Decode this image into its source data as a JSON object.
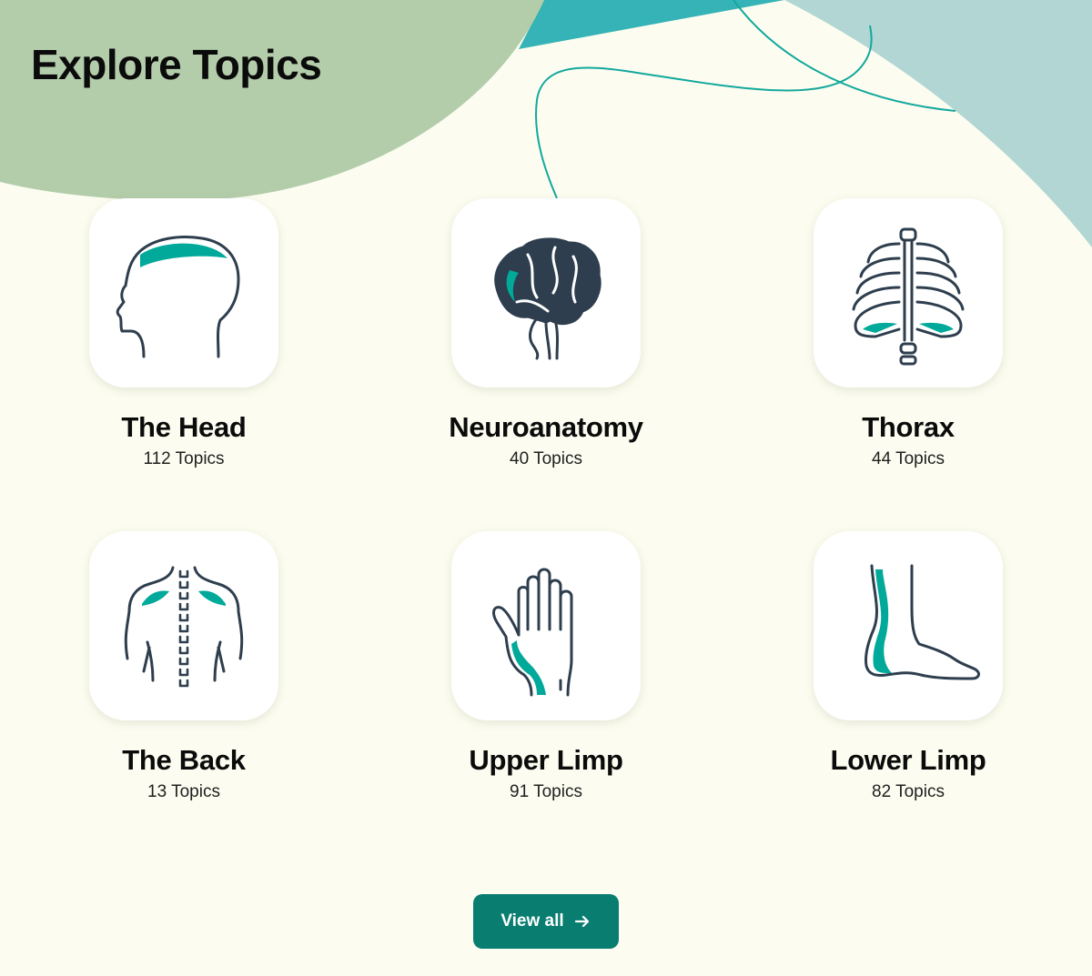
{
  "header": {
    "title": "Explore Topics"
  },
  "colors": {
    "background": "#fcfdf0",
    "sage_blob": "#b3cdaa",
    "teal_blob": "#36b3b6",
    "light_teal_blob": "#b1d6d3",
    "accent": "#00a99a",
    "icon_stroke": "#2e3e4e",
    "button": "#087d70"
  },
  "topics": [
    {
      "title": "The Head",
      "count": "112 Topics",
      "icon": "head-icon"
    },
    {
      "title": "Neuroanatomy",
      "count": "40 Topics",
      "icon": "brain-icon"
    },
    {
      "title": "Thorax",
      "count": "44 Topics",
      "icon": "ribcage-icon"
    },
    {
      "title": "The Back",
      "count": "13 Topics",
      "icon": "back-icon"
    },
    {
      "title": "Upper Limp",
      "count": "91 Topics",
      "icon": "hand-icon"
    },
    {
      "title": "Lower Limp",
      "count": "82 Topics",
      "icon": "foot-icon"
    }
  ],
  "view_all": {
    "label": "View all",
    "icon": "arrow-right-icon"
  }
}
